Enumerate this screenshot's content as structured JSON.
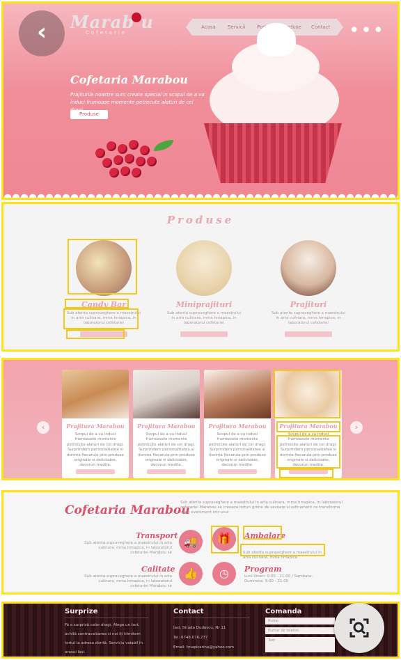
{
  "hero": {
    "logo": "Marab   u",
    "logo_sub": "Cofetarie",
    "nav": [
      "Acasa",
      "Servicii",
      "Portofoliu produse",
      "Contact"
    ],
    "title": "Cofetaria Marabou",
    "tagline": "Prajiturile noastre sunt create special in scopul de a va induci frumoase momente petrecute alaturi de cei dragi.",
    "button": "Produse",
    "more_icon": "•••"
  },
  "products": {
    "title": "Produse",
    "items": [
      {
        "name": "Candy Bar",
        "desc": "Sub atenta supraveghere a maestrului in arta culinara, mma hmapica, in laboratorul cofetariei"
      },
      {
        "name": "Miniprajituri",
        "desc": "Sub atenta supraveghere a maestrului in arta culinara, mma hmapica, in laboratorul cofetariei"
      },
      {
        "name": "Prajituri",
        "desc": "Sub atenta supraveghere a maestrului in arta culinara, mma hmapica, in laboratorul cofetariei"
      }
    ]
  },
  "slider": {
    "prev": "‹",
    "next": "›",
    "cards": [
      {
        "title": "Prajitura Marabou",
        "desc": "Scopul de a va induci frumoasele momente petrecute alaturi de cei dragi. Surprindem personalitatea si dorinta fiecaruia prin produse originale si delicioase, decorun medite."
      },
      {
        "title": "Prajitura Marabou",
        "desc": "Scopul de a va induci frumoasele momente petrecute alaturi de cei dragi. Surprindem personalitatea si dorinta fiecaruia prin produse originale si delicioase, decorun medite."
      },
      {
        "title": "Prajitura Marabou",
        "desc": "Scopul de a va induci frumoasele momente petrecute alaturi de cei dragi. Surprindem personalitatea si dorinta fiecaruia prin produse originale si delicioase, decorun medite."
      },
      {
        "title": "Prajitura Marabou",
        "desc": "Scopul de a va induci frumoasele momente petrecute alaturi de cei dragi. Surprindem personalitatea si dorinta fiecaruia prin produse originale si delicioase, decorun medite."
      }
    ]
  },
  "info": {
    "title": "Cofetaria Marabou",
    "intro": "Sub atenta supraveghere a maestrului in arta culinara, mma hmapica, in laboratorul cofetariei Marabou se creeaza lortun grime de savoare si rafinament ce transforma orice eveniment intr-unul",
    "features": [
      {
        "title": "Transport",
        "desc": "Sub atenta supraveghere a maestrului in arta culinara, mma hmapica, in laboratorul cofetariei Marabou se"
      },
      {
        "title": "Ambalare",
        "desc": "Sub atenta supraveghere a maestrului in arta culinara, mma hmapica"
      },
      {
        "title": "Calitate",
        "desc": "Sub atenta supraveghere a maestrului in arta culinara, mma hmapica, in laboratorul cofetariei Marabou se"
      },
      {
        "title": "Program",
        "desc": "Luni-Vineri: 9:00 - 21:00 / Sambata-Duminica: 9:00 - 21:00"
      }
    ]
  },
  "footer": {
    "surprize": {
      "title": "Surprize",
      "lines": [
        "Fă o surpriză celor dragi. Alege un tort,",
        "achită contravaloarea si noi iți trimitem",
        "tortul la adresa dorită. Serviciu valabil în",
        "orasul Iasi."
      ]
    },
    "contact": {
      "title": "Contact",
      "lines": [
        "Iasi, Strada Dudescu, Nr 11",
        "Tel: 0748.076.237",
        "Email: hnapicarina@yahoo.com"
      ]
    },
    "comanda": {
      "title": "Comanda",
      "fields": [
        "Nume",
        "Numar de telefon",
        "Text"
      ]
    }
  },
  "colors": {
    "pink": "#ef8793",
    "accent": "#d84f68",
    "highlight": "#ffe21a",
    "footer": "#3b1a1e"
  }
}
